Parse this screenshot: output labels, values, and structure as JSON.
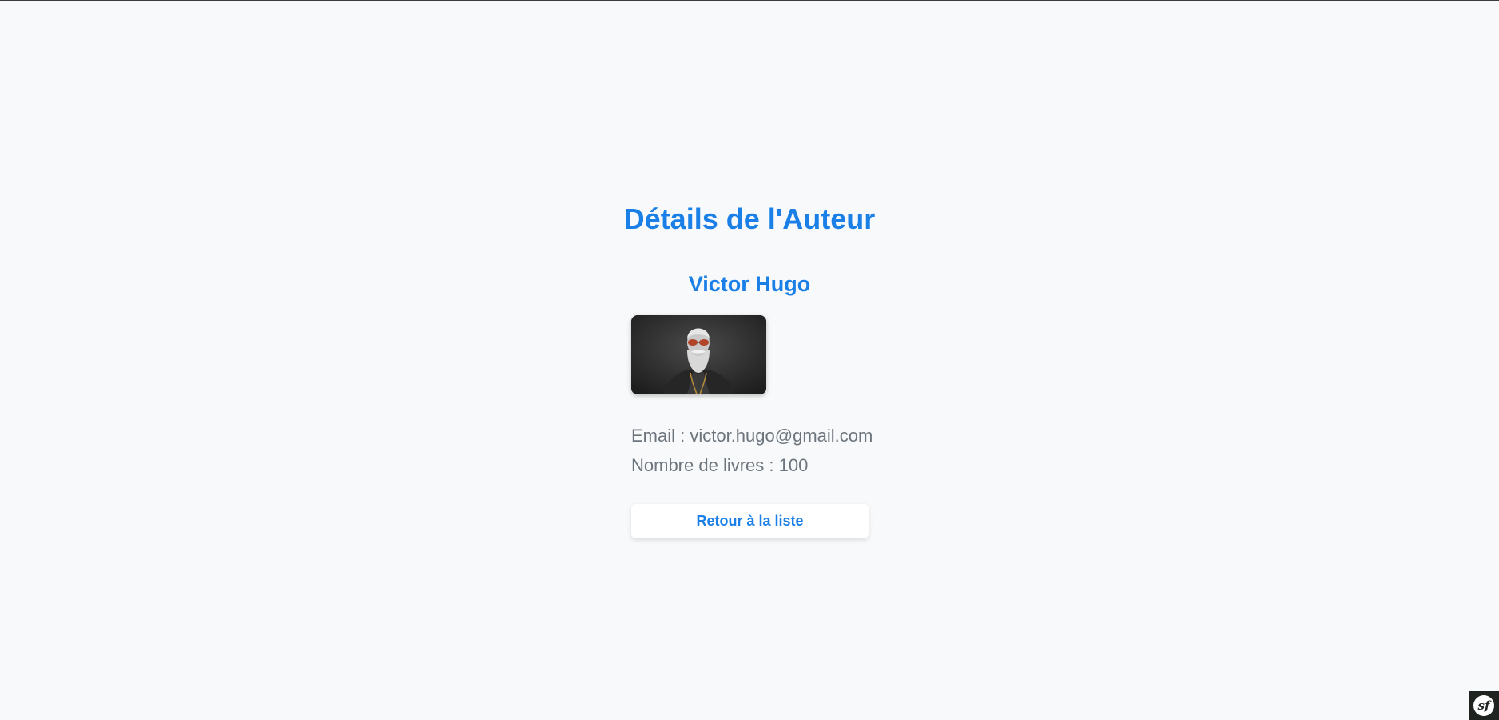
{
  "page": {
    "title": "Détails de l'Auteur"
  },
  "author": {
    "name": "Victor Hugo",
    "email_line": "Email : victor.hugo@gmail.com",
    "books_line": "Nombre de livres : 100"
  },
  "actions": {
    "back_label": "Retour à la liste"
  },
  "toolbar": {
    "symfony_logo_text": "sf"
  },
  "colors": {
    "accent": "#1a7fe6",
    "text_muted": "#6c757d",
    "background": "#f8f9fa"
  },
  "icons": {
    "debug_toolbar": "symfony-logo-icon"
  }
}
